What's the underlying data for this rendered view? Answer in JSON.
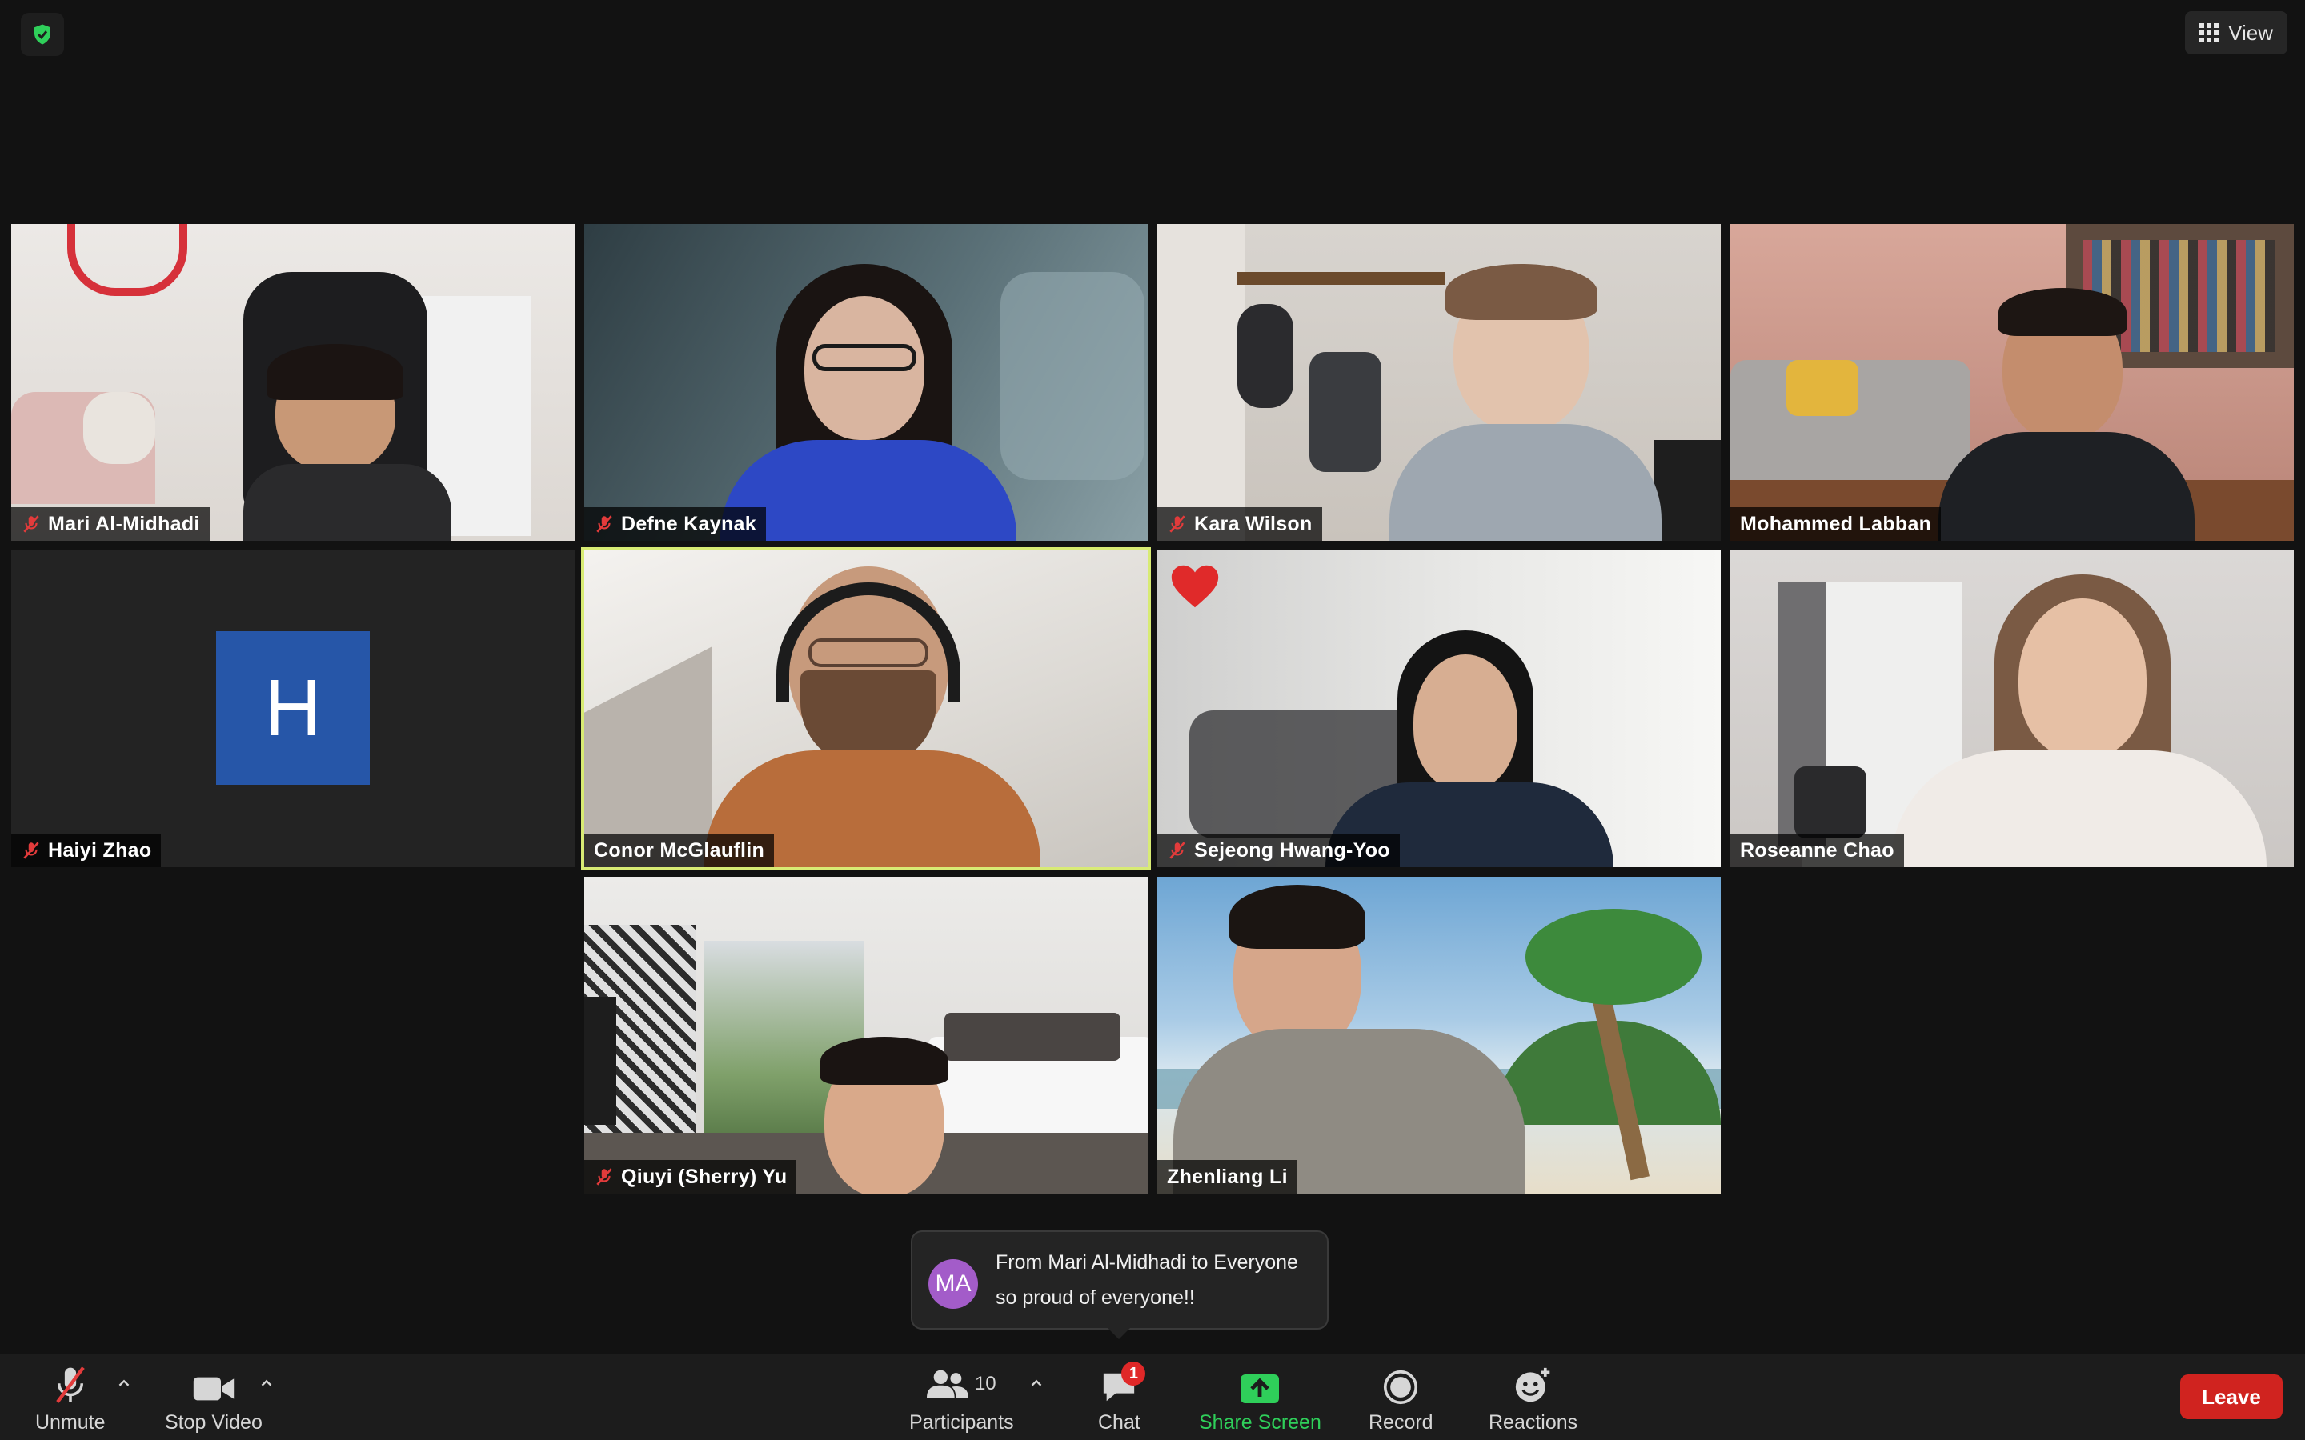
{
  "window": {
    "view_label": "View",
    "icons": {
      "security": "shield-check-icon",
      "view": "grid-icon"
    }
  },
  "participants": [
    {
      "name": "Mari Al-Midhadi",
      "muted": true
    },
    {
      "name": "Defne Kaynak",
      "muted": true
    },
    {
      "name": "Kara Wilson",
      "muted": true
    },
    {
      "name": "Mohammed Labban",
      "muted": false
    },
    {
      "name": "Haiyi Zhao",
      "muted": true,
      "avatar_initial": "H",
      "video_off": true
    },
    {
      "name": "Conor McGlauflin",
      "muted": false,
      "active_speaker": true
    },
    {
      "name": "Sejeong Hwang-Yoo",
      "muted": true,
      "reaction": "heart-icon"
    },
    {
      "name": "Roseanne Chao",
      "muted": false
    },
    {
      "name": "Qiuyi (Sherry) Yu",
      "muted": true
    },
    {
      "name": "Zhenliang Li",
      "muted": false
    }
  ],
  "chat_toast": {
    "initials": "MA",
    "from": "From Mari Al-Midhadi to Everyone",
    "message": "so proud of everyone!!"
  },
  "toolbar": {
    "unmute": "Unmute",
    "stop_video": "Stop Video",
    "participants": "Participants",
    "participants_count": "10",
    "chat": "Chat",
    "chat_badge": "1",
    "share_screen": "Share Screen",
    "record": "Record",
    "reactions": "Reactions",
    "leave": "Leave"
  },
  "colors": {
    "background": "#121212",
    "active_speaker_border": "#d8eb74",
    "share_green": "#2fcf5a",
    "leave_red": "#d0231f",
    "avatar_blue": "#2656a8",
    "toast_avatar": "#a35cc9"
  }
}
